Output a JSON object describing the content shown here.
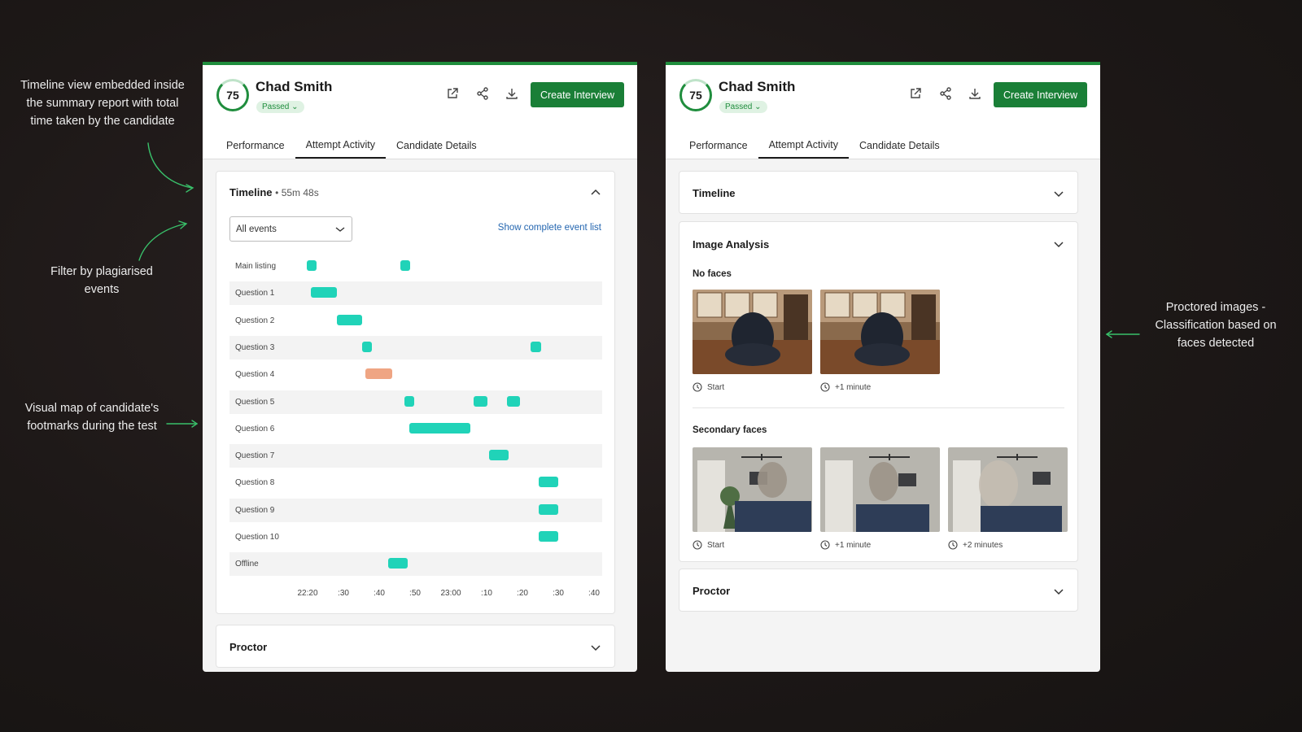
{
  "annotations": {
    "timeline_view": [
      "Timeline view embedded inside",
      "the summary report with total",
      "time taken by the candidate"
    ],
    "filter": [
      "Filter by plagiarised",
      "events"
    ],
    "visual_map": [
      "Visual map of candidate's",
      "footmarks during the test"
    ],
    "proctored": [
      "Proctored images -",
      "Classification based on",
      "faces detected"
    ]
  },
  "candidate": {
    "score": "75",
    "name": "Chad Smith",
    "status": "Passed"
  },
  "header": {
    "cta_label": "Create Interview",
    "icons": [
      "external-link-icon",
      "share-icon",
      "download-icon"
    ]
  },
  "tabs": [
    "Performance",
    "Attempt Activity",
    "Candidate Details"
  ],
  "active_tab": "Attempt Activity",
  "left": {
    "timeline": {
      "title": "Timeline",
      "duration": "55m 48s",
      "filter_value": "All events",
      "show_all_label": "Show complete event list",
      "x_ticks": [
        "22:20",
        ":30",
        ":40",
        ":50",
        "23:00",
        ":10",
        ":20",
        ":30",
        ":40"
      ],
      "rows": [
        {
          "label": "Main listing",
          "bars": [
            [
              0.04,
              0.03
            ],
            [
              0.35,
              0.02
            ]
          ]
        },
        {
          "label": "Question 1",
          "bars": [
            [
              0.055,
              0.085
            ]
          ]
        },
        {
          "label": "Question 2",
          "bars": [
            [
              0.14,
              0.085
            ]
          ]
        },
        {
          "label": "Question 3",
          "bars": [
            [
              0.225,
              0.02
            ],
            [
              0.785,
              0.035
            ]
          ]
        },
        {
          "label": "Question 4",
          "bars": [
            [
              0.235,
              0.09
            ]
          ],
          "warn": true
        },
        {
          "label": "Question 5",
          "bars": [
            [
              0.365,
              0.02
            ],
            [
              0.595,
              0.045
            ],
            [
              0.705,
              0.045
            ]
          ]
        },
        {
          "label": "Question 6",
          "bars": [
            [
              0.38,
              0.205
            ]
          ]
        },
        {
          "label": "Question 7",
          "bars": [
            [
              0.645,
              0.065
            ]
          ]
        },
        {
          "label": "Question 8",
          "bars": [
            [
              0.81,
              0.065
            ]
          ]
        },
        {
          "label": "Question 9",
          "bars": [
            [
              0.81,
              0.065
            ]
          ]
        },
        {
          "label": "Question 10",
          "bars": [
            [
              0.81,
              0.065
            ]
          ]
        },
        {
          "label": "Offline",
          "bars": [
            [
              0.31,
              0.065
            ]
          ]
        }
      ]
    },
    "proctor_title": "Proctor"
  },
  "right": {
    "timeline_title": "Timeline",
    "image_analysis": {
      "title": "Image Analysis",
      "no_faces_label": "No faces",
      "no_faces_captions": [
        "Start",
        "+1 minute"
      ],
      "secondary_label": "Secondary faces",
      "secondary_captions": [
        "Start",
        "+1 minute",
        "+2 minutes"
      ]
    },
    "proctor_title": "Proctor"
  },
  "colors": {
    "accent": "#1a7f37",
    "bar": "#20d3b8",
    "bar_warn": "#efa583",
    "link": "#2466b0"
  }
}
